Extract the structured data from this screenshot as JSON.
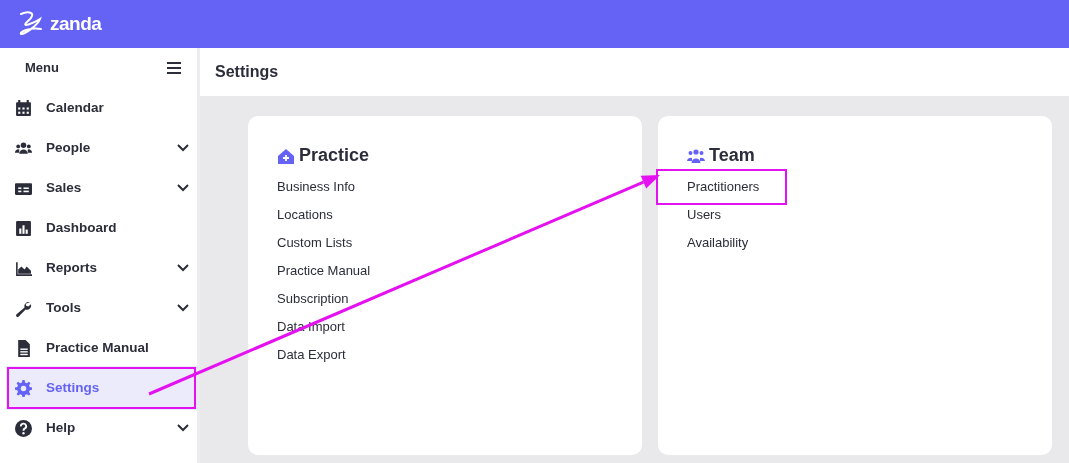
{
  "brand": "zanda",
  "sidebar": {
    "title": "Menu",
    "items": [
      {
        "label": "Calendar",
        "expandable": false,
        "selected": false,
        "highlighted": false
      },
      {
        "label": "People",
        "expandable": true,
        "selected": false,
        "highlighted": false
      },
      {
        "label": "Sales",
        "expandable": true,
        "selected": false,
        "highlighted": false
      },
      {
        "label": "Dashboard",
        "expandable": false,
        "selected": false,
        "highlighted": false
      },
      {
        "label": "Reports",
        "expandable": true,
        "selected": false,
        "highlighted": false
      },
      {
        "label": "Tools",
        "expandable": true,
        "selected": false,
        "highlighted": false
      },
      {
        "label": "Practice Manual",
        "expandable": false,
        "selected": false,
        "highlighted": false
      },
      {
        "label": "Settings",
        "expandable": false,
        "selected": true,
        "highlighted": true
      },
      {
        "label": "Help",
        "expandable": true,
        "selected": false,
        "highlighted": false
      }
    ]
  },
  "page_title": "Settings",
  "cards": [
    {
      "title": "Practice",
      "links": [
        {
          "label": "Business Info",
          "highlighted": false
        },
        {
          "label": "Locations",
          "highlighted": false
        },
        {
          "label": "Custom Lists",
          "highlighted": false
        },
        {
          "label": "Practice Manual",
          "highlighted": false
        },
        {
          "label": "Subscription",
          "highlighted": false
        },
        {
          "label": "Data Import",
          "highlighted": false
        },
        {
          "label": "Data Export",
          "highlighted": false
        }
      ]
    },
    {
      "title": "Team",
      "links": [
        {
          "label": "Practitioners",
          "highlighted": true
        },
        {
          "label": "Users",
          "highlighted": false
        },
        {
          "label": "Availability",
          "highlighted": false
        }
      ]
    }
  ],
  "annotation_arrow": true
}
